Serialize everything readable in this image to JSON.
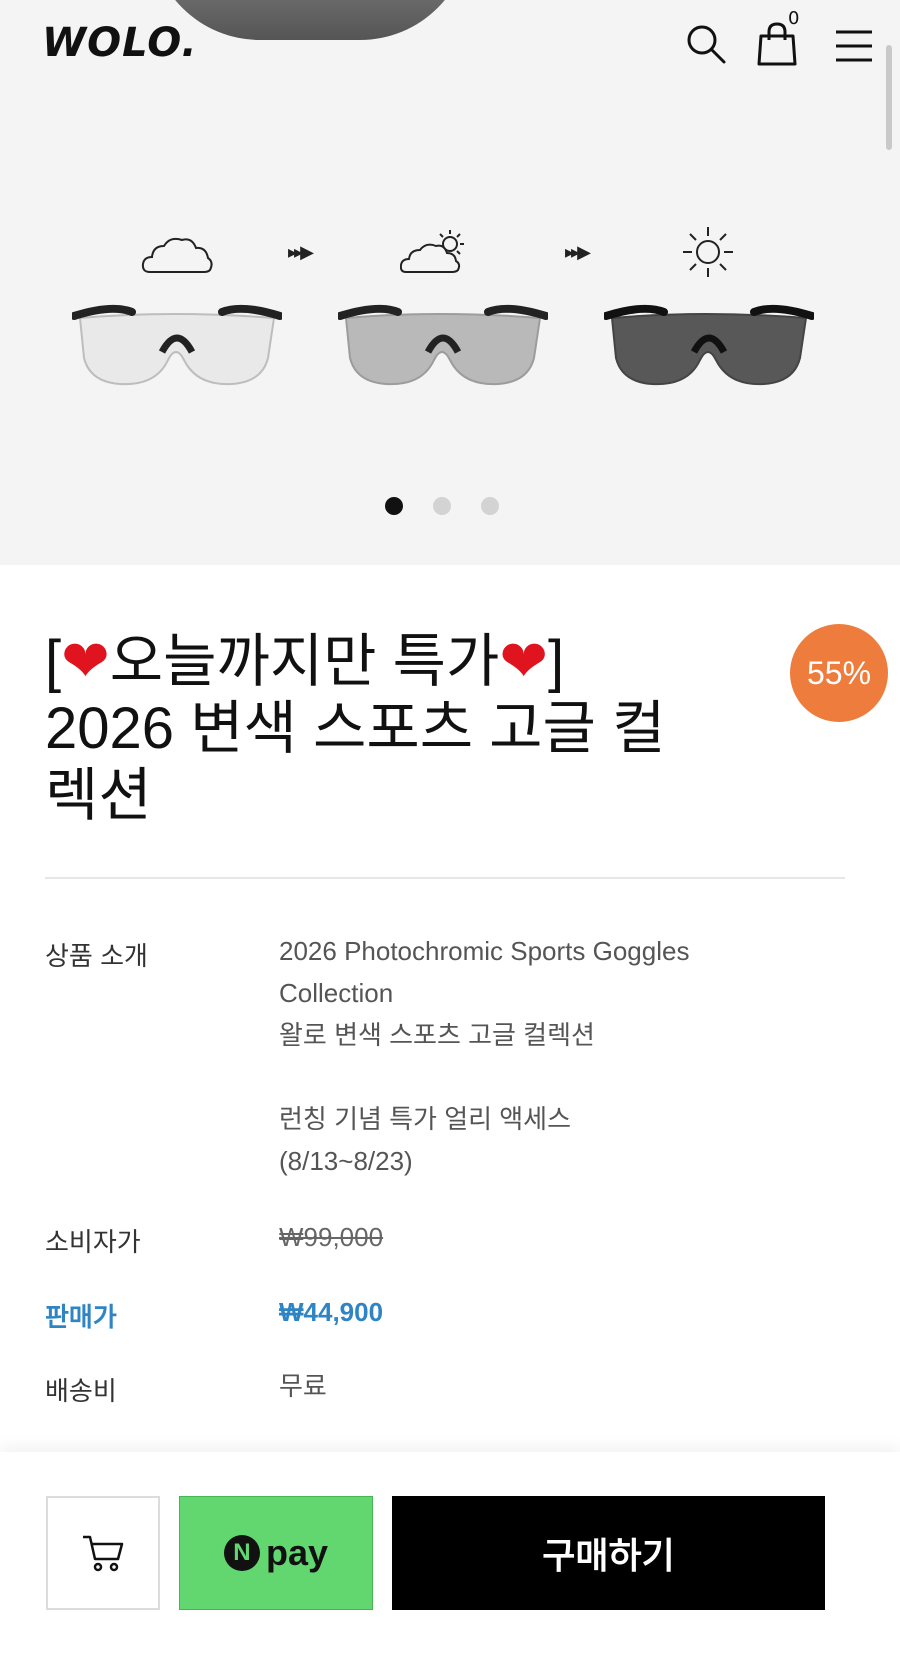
{
  "header": {
    "logo": "WOLO.",
    "cart_count": "0",
    "icons": [
      "search-icon",
      "shopping-bag-icon",
      "hamburger-menu-icon"
    ]
  },
  "hero": {
    "stages": [
      "cloud",
      "cloud-sun",
      "sun"
    ],
    "carousel": {
      "total": 3,
      "active": 1
    }
  },
  "product": {
    "title_line1_mid": "오늘까지만 특가",
    "title_bracket_open": "[",
    "title_bracket_close": "]",
    "title_line2": "2026 변색 스포츠 고글 컬",
    "title_line3": "렉션",
    "discount_badge": "55%",
    "info": {
      "intro_label": "상품 소개",
      "intro_line1": "2026 Photochromic Sports Goggles",
      "intro_line2": "Collection",
      "intro_line3": "왈로 변색 스포츠 고글 컬렉션",
      "intro_line4": "런칭 기념 특가 얼리 액세스",
      "intro_line5": "(8/13~8/23)",
      "retail_label": "소비자가",
      "retail_price": "₩99,000",
      "sale_label": "판매가",
      "sale_price": "₩44,900",
      "shipping_label": "배송비",
      "shipping_value": "무료"
    }
  },
  "actions": {
    "npay_letter": "N",
    "npay_text": "pay",
    "buy_label": "구매하기"
  },
  "colors": {
    "sale_blue": "#2f85c4",
    "badge_orange": "#ee7d3d",
    "npay_green": "#62d66f"
  }
}
